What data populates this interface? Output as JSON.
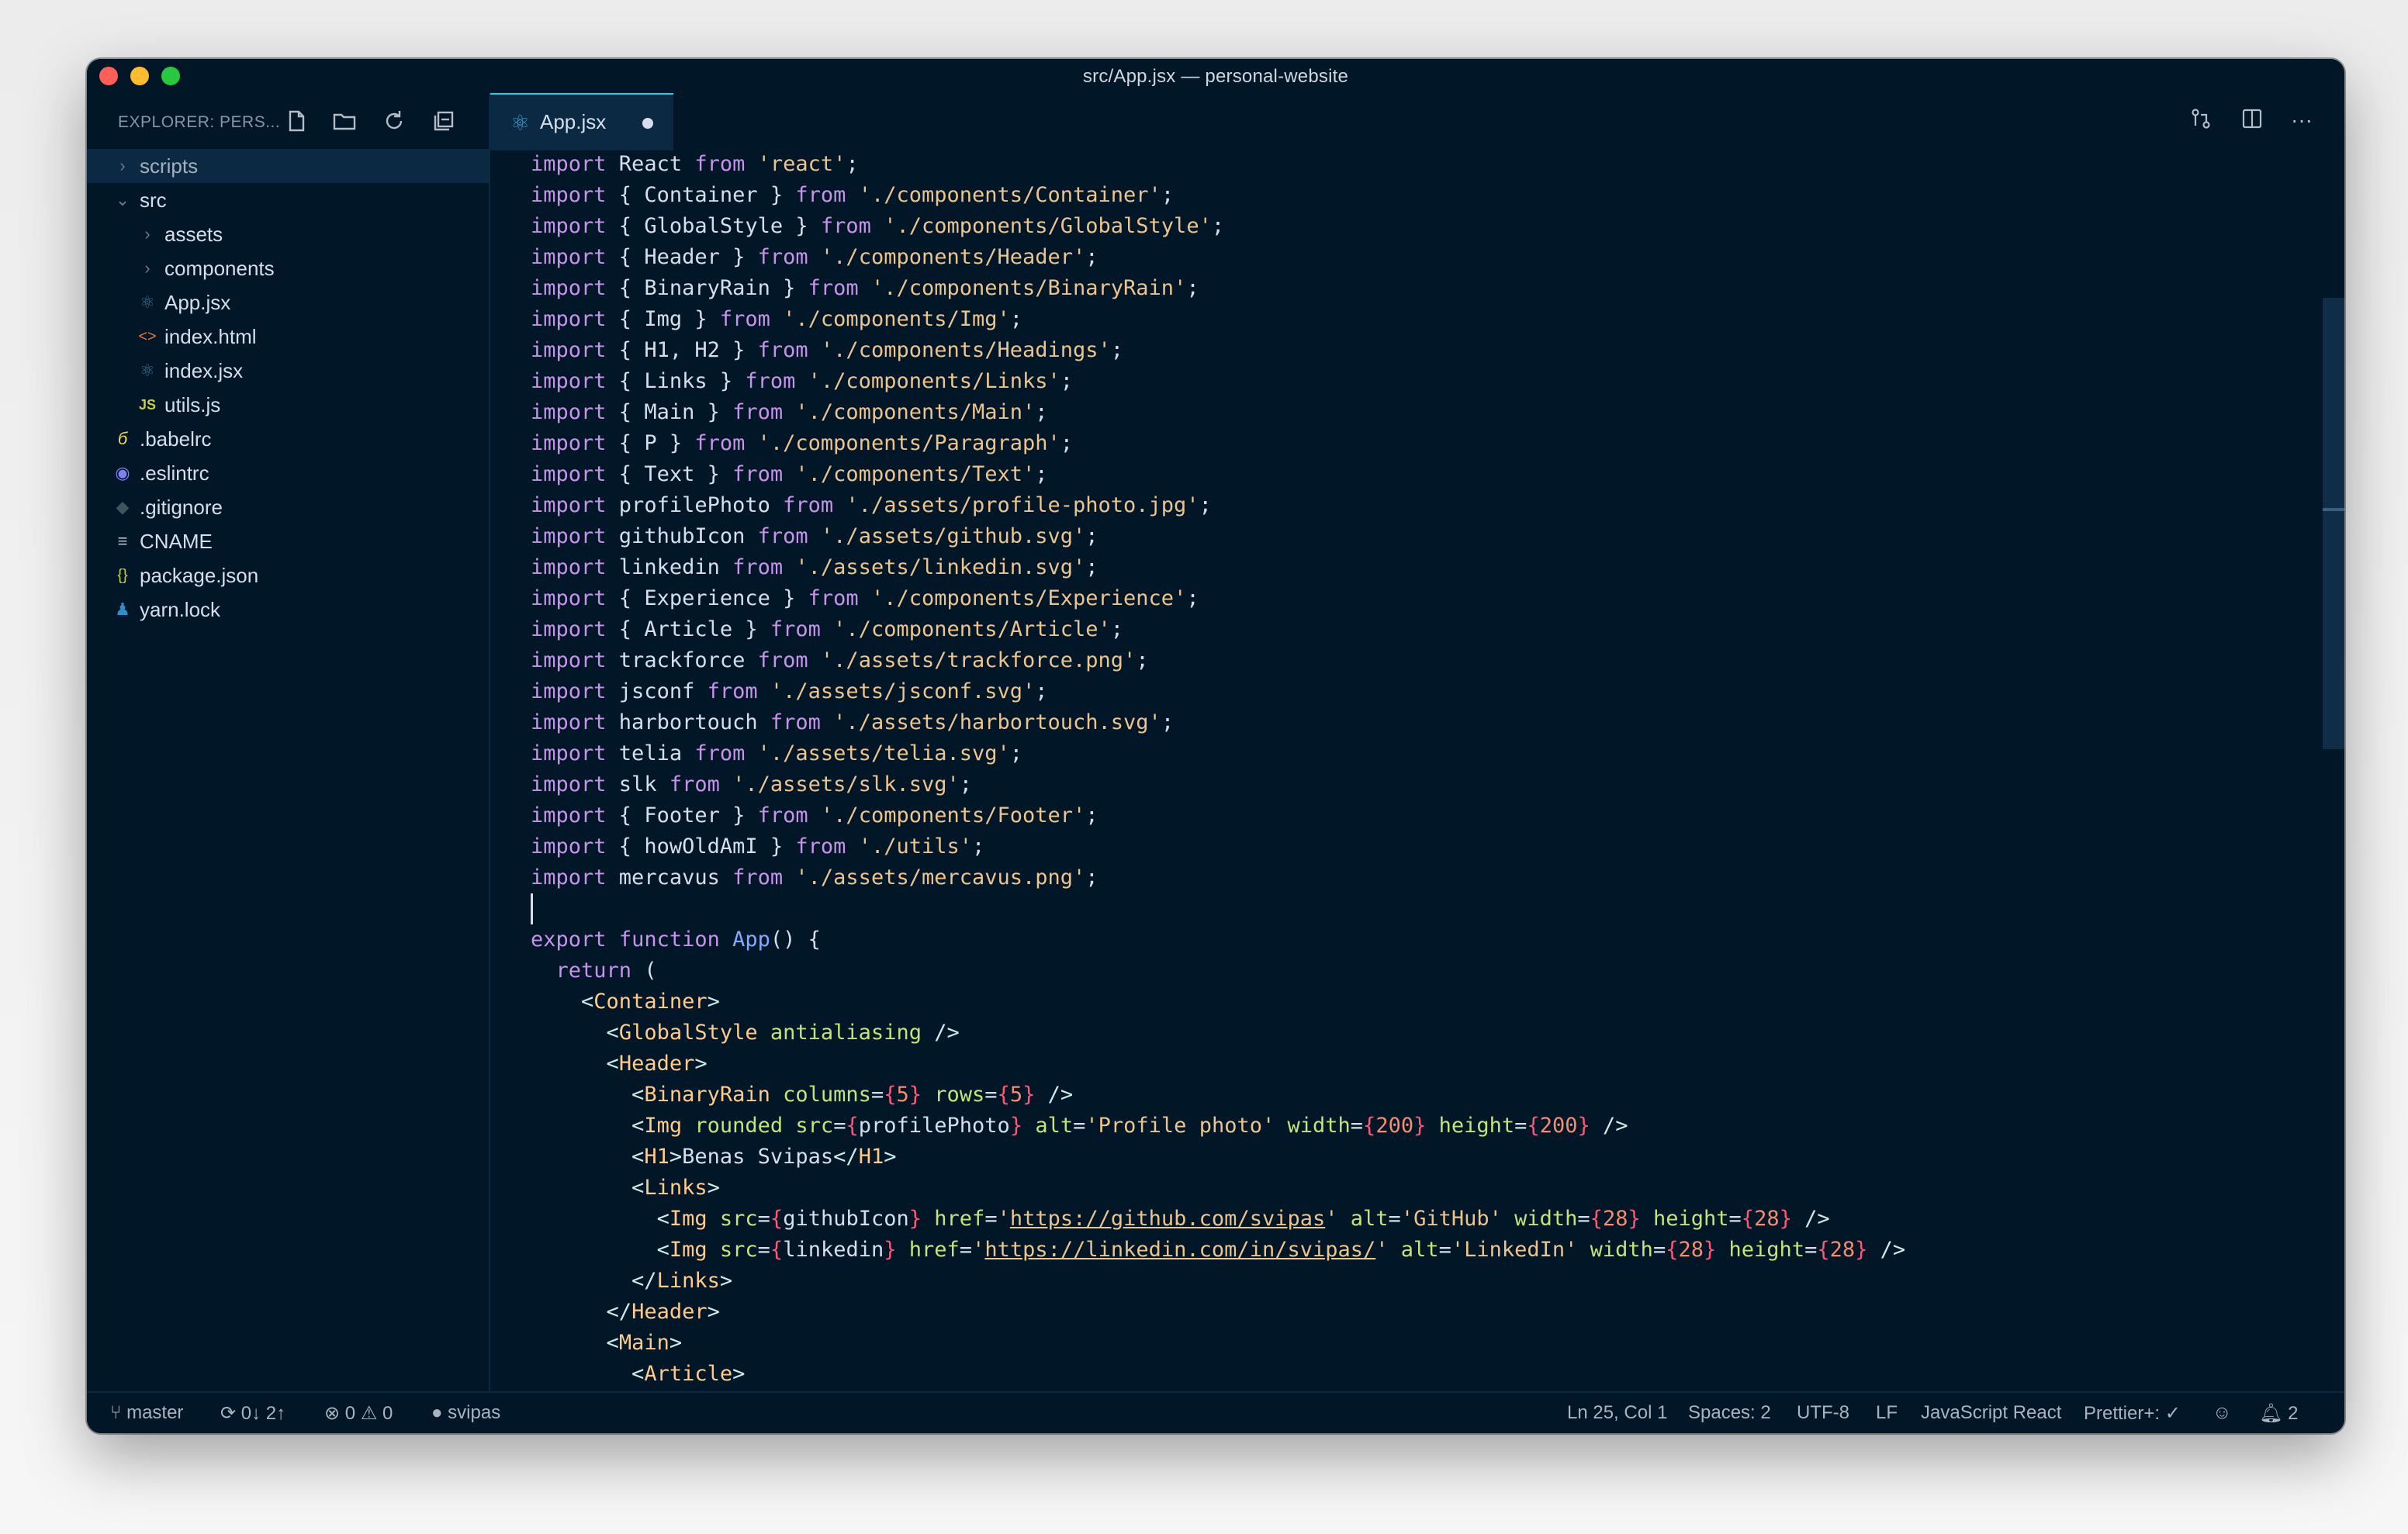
{
  "window": {
    "title": "src/App.jsx — personal-website"
  },
  "sidebar": {
    "title": "EXPLORER: PERS...",
    "actions": [
      "new-file-icon",
      "new-folder-icon",
      "refresh-icon",
      "collapse-all-icon"
    ],
    "items": [
      {
        "label": "scripts",
        "icon": "chevron-right-icon"
      },
      {
        "label": "src",
        "icon": "chevron-down-icon"
      },
      {
        "label": "assets",
        "icon": "chevron-right-icon"
      },
      {
        "label": "components",
        "icon": "chevron-right-icon"
      },
      {
        "label": "App.jsx",
        "icon": "react-icon"
      },
      {
        "label": "index.html",
        "icon": "html-icon"
      },
      {
        "label": "index.jsx",
        "icon": "react-icon"
      },
      {
        "label": "utils.js",
        "icon": "js-icon",
        "glyph": "JS"
      },
      {
        "label": ".babelrc",
        "icon": "babel-icon"
      },
      {
        "label": ".eslintrc",
        "icon": "eslint-icon"
      },
      {
        "label": ".gitignore",
        "icon": "git-icon"
      },
      {
        "label": "CNAME",
        "icon": "lines-icon"
      },
      {
        "label": "package.json",
        "icon": "json-icon",
        "glyph": "{}"
      },
      {
        "label": "yarn.lock",
        "icon": "yarn-icon"
      }
    ]
  },
  "tabs": [
    {
      "label": "App.jsx",
      "modified": true
    }
  ],
  "editor_actions": [
    "source-control-icon",
    "split-editor-icon",
    "more-icon"
  ],
  "editor": {
    "lines": [
      "import React from 'react';",
      "import { Container } from './components/Container';",
      "import { GlobalStyle } from './components/GlobalStyle';",
      "import { Header } from './components/Header';",
      "import { BinaryRain } from './components/BinaryRain';",
      "import { Img } from './components/Img';",
      "import { H1, H2 } from './components/Headings';",
      "import { Links } from './components/Links';",
      "import { Main } from './components/Main';",
      "import { P } from './components/Paragraph';",
      "import { Text } from './components/Text';",
      "import profilePhoto from './assets/profile-photo.jpg';",
      "import githubIcon from './assets/github.svg';",
      "import linkedin from './assets/linkedin.svg';",
      "import { Experience } from './components/Experience';",
      "import { Article } from './components/Article';",
      "import trackforce from './assets/trackforce.png';",
      "import jsconf from './assets/jsconf.svg';",
      "import harbortouch from './assets/harbortouch.svg';",
      "import telia from './assets/telia.svg';",
      "import slk from './assets/slk.svg';",
      "import { Footer } from './components/Footer';",
      "import { howOldAmI } from './utils';",
      "import mercavus from './assets/mercavus.png';",
      "",
      "export function App() {",
      "  return (",
      "    <Container>",
      "      <GlobalStyle antialiasing />",
      "      <Header>",
      "        <BinaryRain columns={5} rows={5} />",
      "        <Img rounded src={profilePhoto} alt='Profile photo' width={200} height={200} />",
      "        <H1>Benas Svipas</H1>",
      "        <Links>",
      "          <Img src={githubIcon} href='https://github.com/svipas' alt='GitHub' width={28} height={28} />",
      "          <Img src={linkedin} href='https://linkedin.com/in/svipas/' alt='LinkedIn' width={28} height={28} />",
      "        </Links>",
      "      </Header>",
      "      <Main>",
      "        <Article>"
    ]
  },
  "status": {
    "branch": "master",
    "sync": "0↓ 2↑",
    "errors": "0",
    "warnings": "0",
    "user": "svipas",
    "position": "Ln 25, Col 1",
    "spaces": "Spaces: 2",
    "encoding": "UTF-8",
    "eol": "LF",
    "language": "JavaScript React",
    "formatter": "Prettier+: ✓",
    "notifications": "2"
  },
  "colors": {
    "background": "#011627",
    "keyword": "#c792ea",
    "string": "#ecc48d",
    "jsx_component": "#ffcb8b",
    "attribute": "#c5e478",
    "number": "#f78c6c",
    "function": "#82aaff"
  }
}
